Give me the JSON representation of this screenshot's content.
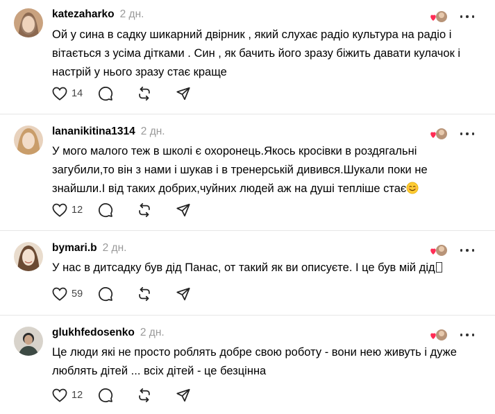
{
  "posts": [
    {
      "username": "katezaharko",
      "time": "2 дн.",
      "text": "Ой у сина в садку шикарний двірник , який слухає радіо культура на радіо і\nвітається з усіма дітками . Син , як бачить його зразу біжить давати кулачок і\nнастрій у нього зразу стає краще",
      "likes": "14",
      "avatar_colors": [
        "#c9a27f",
        "#e7c9ad",
        "#5a3b2a"
      ]
    },
    {
      "username": "lananikitina1314",
      "time": "2 дн.",
      "text": "У мого малого теж в школі є охоронець.Якось кросівки в роздягальні\nзагубили,то він з нами і шукав і в тренерській дивився.Шукали поки не\nзнайшли.І від таких добрих,чуйних людей аж на душі тепліше стає",
      "likes": "12",
      "avatar_colors": [
        "#e0bfa3",
        "#f2dcc8",
        "#c99d6a"
      ]
    },
    {
      "username": "bymari.b",
      "time": "2 дн.",
      "text": "У нас в дитсадку був дід Панас, от такий як ви описуєте. І це був мій дід",
      "likes": "59",
      "avatar_colors": [
        "#d3b49a",
        "#f3e0cf",
        "#6b4a33"
      ]
    },
    {
      "username": "glukhfedosenko",
      "time": "2 дн.",
      "text": "Це люди які не просто роблять добре свою роботу - вони нею живуть і дуже\nлюблять дітей ... всіх дітей - це безцінна",
      "likes": "12",
      "avatar_colors": [
        "#7f8a83",
        "#d8d3cb",
        "#2b2b2b"
      ]
    }
  ],
  "icons": {
    "like": "heart-outline-icon",
    "comment": "comment-bubble-icon",
    "repost": "repost-arrows-icon",
    "share": "send-paper-plane-icon",
    "more": "more-dots-icon",
    "author_like": "author-liked-badge-icon"
  },
  "colors": {
    "liked_heart": "#ff2d55",
    "muted_text": "#999999",
    "divider": "#e6e6e6"
  }
}
